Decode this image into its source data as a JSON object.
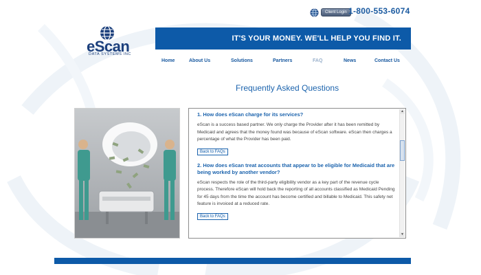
{
  "header": {
    "client_login_label": "Client Login",
    "phone": "1-800-553-6074"
  },
  "logo": {
    "name": "eScan",
    "subtitle": "DATA SYSTEMS INC"
  },
  "banner": {
    "tagline": "IT'S YOUR MONEY. WE'LL HELP YOU FIND IT."
  },
  "nav": {
    "items": [
      {
        "label": "Home"
      },
      {
        "label": "About Us"
      },
      {
        "label": "Solutions"
      },
      {
        "label": "Partners"
      },
      {
        "label": "FAQ",
        "active": true
      },
      {
        "label": "News"
      },
      {
        "label": "Contact Us"
      }
    ]
  },
  "main": {
    "title": "Frequently Asked Questions"
  },
  "faq": {
    "items": [
      {
        "question": "1. How does eScan charge for its services?",
        "answer": "eScan is a success based partner. We only charge the Provider after it has been remitted by Medicaid and agrees that the money found was because of eScan software. eScan then charges a percentage of what the Provider has been paid.",
        "back_label": "Back to FAQs"
      },
      {
        "question": "2. How does eScan treat accounts that appear to be eligible for Medicaid that are being worked by another vendor?",
        "answer": "eScan respects the role of the third-party eligibility vendor as a key part of the revenue cycle process. Therefore eScan will hold back the reporting of all accounts classified as Medicaid Pending for 45 days from the time the account has become certified and billable to Medicaid. This safety net feature is invoiced at a reduced rate.",
        "back_label": "Back to FAQs"
      }
    ]
  },
  "icons": {
    "client_login": "globe-icon",
    "logo": "globe-logo-icon",
    "scroll_up": "scroll-up-arrow-icon",
    "scroll_down": "scroll-down-arrow-icon"
  },
  "colors": {
    "brand_blue": "#0d5aa8",
    "link_blue": "#1a5aa0",
    "active_nav": "#9ab1cc"
  }
}
